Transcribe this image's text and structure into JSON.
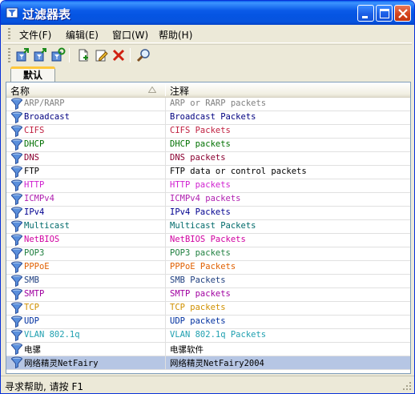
{
  "window": {
    "title": "过滤器表"
  },
  "menu": [
    {
      "label": "文件(F)"
    },
    {
      "label": "编辑(E)"
    },
    {
      "label": "窗口(W)"
    },
    {
      "label": "帮助(H)"
    }
  ],
  "toolbar": {
    "buttons": [
      "import-icon",
      "export-icon",
      "refresh-icon",
      "new-icon",
      "edit-icon",
      "delete-icon",
      "find-icon"
    ]
  },
  "tabs": [
    {
      "label": "默认"
    }
  ],
  "list": {
    "columns": {
      "name": "名称",
      "note": "注释"
    },
    "rows": [
      {
        "name": "ARP/RARP",
        "note": "ARP or RARP packets",
        "color": "#808080"
      },
      {
        "name": "Broadcast",
        "note": "Broadcast Packets",
        "color": "#000080"
      },
      {
        "name": "CIFS",
        "note": "CIFS Packets",
        "color": "#C02040"
      },
      {
        "name": "DHCP",
        "note": "DHCP packets",
        "color": "#007000"
      },
      {
        "name": "DNS",
        "note": "DNS packets",
        "color": "#8A0030"
      },
      {
        "name": "FTP",
        "note": "FTP data or control packets",
        "color": "#000000"
      },
      {
        "name": "HTTP",
        "note": "HTTP  packets",
        "color": "#D020D0"
      },
      {
        "name": "ICMPv4",
        "note": "ICMPv4 packets",
        "color": "#B020B0"
      },
      {
        "name": "IPv4",
        "note": "IPv4 Packets",
        "color": "#000090"
      },
      {
        "name": "Multicast",
        "note": "Multicast Packets",
        "color": "#006A6A"
      },
      {
        "name": "NetBIOS",
        "note": "NetBIOS Packets",
        "color": "#D000A0"
      },
      {
        "name": "POP3",
        "note": "POP3 packets",
        "color": "#208040"
      },
      {
        "name": "PPPoE",
        "note": "PPPoE Packets",
        "color": "#E06000"
      },
      {
        "name": "SMB",
        "note": "SMB Packets",
        "color": "#204080"
      },
      {
        "name": "SMTP",
        "note": "SMTP packets",
        "color": "#A000A0"
      },
      {
        "name": "TCP",
        "note": "TCP packets",
        "color": "#D09000"
      },
      {
        "name": "UDP",
        "note": "UDP packets",
        "color": "#0030A0"
      },
      {
        "name": "VLAN 802.1q",
        "note": "VLAN 802.1q Packets",
        "color": "#20A0B0"
      },
      {
        "name": "电骡",
        "note": "电骡软件",
        "color": "#000000"
      },
      {
        "name": "网络精灵NetFairy",
        "note": "网络精灵NetFairy2004",
        "color": "#000000",
        "selected": true
      }
    ]
  },
  "status": {
    "text": "寻求帮助, 请按 F1"
  }
}
